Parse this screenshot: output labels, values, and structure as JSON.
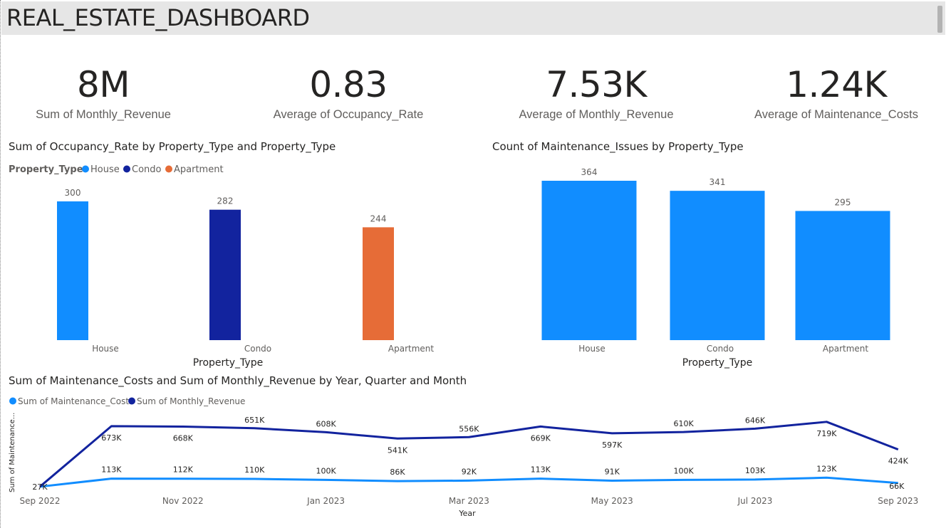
{
  "header": {
    "title": "REAL_ESTATE_DASHBOARD"
  },
  "kpis": [
    {
      "value": "8M",
      "label": "Sum of Monthly_Revenue"
    },
    {
      "value": "0.83",
      "label": "Average of Occupancy_Rate"
    },
    {
      "value": "7.53K",
      "label": "Average of Monthly_Revenue"
    },
    {
      "value": "1.24K",
      "label": "Average of Maintenance_Costs"
    }
  ],
  "colors": {
    "house": "#118dff",
    "condo": "#12239e",
    "apartment": "#e66c37",
    "line_costs": "#118dff",
    "line_revenue": "#12239e"
  },
  "chart_data": [
    {
      "type": "bar",
      "title": "Sum of Occupancy_Rate by Property_Type and Property_Type",
      "legend_title": "Property_Type",
      "legend_position": "top-left",
      "categories": [
        "House",
        "Condo",
        "Apartment"
      ],
      "series": [
        {
          "name": "House",
          "values": [
            300,
            null,
            null
          ]
        },
        {
          "name": "Condo",
          "values": [
            null,
            282,
            null
          ]
        },
        {
          "name": "Apartment",
          "values": [
            null,
            null,
            244
          ]
        }
      ],
      "values": [
        300,
        282,
        244
      ],
      "data_labels": [
        "300",
        "282",
        "244"
      ],
      "xlabel": "Property_Type",
      "ylabel": "",
      "ylim": [
        0,
        300
      ],
      "grid": false
    },
    {
      "type": "bar",
      "title": "Count of Maintenance_Issues by Property_Type",
      "categories": [
        "House",
        "Condo",
        "Apartment"
      ],
      "values": [
        364,
        341,
        295
      ],
      "data_labels": [
        "364",
        "341",
        "295"
      ],
      "xlabel": "Property_Type",
      "ylabel": "",
      "ylim": [
        0,
        364
      ],
      "grid": false
    },
    {
      "type": "line",
      "title": "Sum of Maintenance_Costs and Sum of Monthly_Revenue by Year, Quarter and Month",
      "legend_position": "top-left",
      "xlabel": "Year",
      "ylabel": "Sum of Maintenance...",
      "x": [
        "Sep 2022",
        "Oct 2022",
        "Nov 2022",
        "Dec 2022",
        "Jan 2023",
        "Feb 2023",
        "Mar 2023",
        "Apr 2023",
        "May 2023",
        "Jun 2023",
        "Jul 2023",
        "Aug 2023",
        "Sep 2023"
      ],
      "x_tick_labels": [
        "Sep 2022",
        "Nov 2022",
        "Jan 2023",
        "Mar 2023",
        "May 2023",
        "Jul 2023",
        "Sep 2023"
      ],
      "series": [
        {
          "name": "Sum of Maintenance_Costs",
          "values": [
            27,
            113,
            112,
            110,
            100,
            86,
            92,
            113,
            91,
            100,
            103,
            123,
            66
          ],
          "labels": [
            "27K",
            "113K",
            "112K",
            "110K",
            "100K",
            "86K",
            "92K",
            "113K",
            "91K",
            "100K",
            "103K",
            "123K",
            "66K"
          ]
        },
        {
          "name": "Sum of Monthly_Revenue",
          "values": [
            null,
            673,
            668,
            651,
            608,
            541,
            556,
            669,
            597,
            610,
            646,
            719,
            424
          ],
          "labels": [
            "",
            "673K",
            "668K",
            "651K",
            "608K",
            "541K",
            "556K",
            "669K",
            "597K",
            "610K",
            "646K",
            "719K",
            "424K"
          ]
        }
      ],
      "grid": false
    }
  ]
}
